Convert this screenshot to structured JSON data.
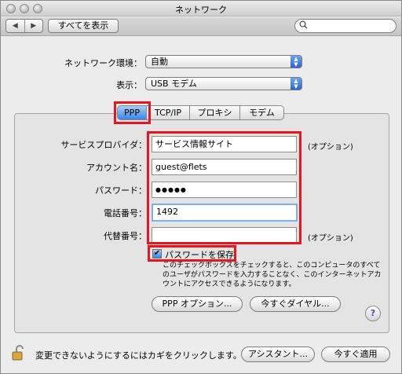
{
  "window": {
    "title": "ネットワーク"
  },
  "toolbar": {
    "back": "◀",
    "forward": "▶",
    "show_all": "すべてを表示",
    "search_placeholder": ""
  },
  "top": {
    "location_label": "ネットワーク環境：",
    "location_value": "自動",
    "show_label": "表示：",
    "show_value": "USB モデム"
  },
  "tabs": [
    "PPP",
    "TCP/IP",
    "プロキシ",
    "モデム"
  ],
  "form": {
    "service_provider_label": "サービスプロバイダ：",
    "service_provider_value": "サービス情報サイト",
    "service_provider_optional": "(オプション)",
    "account_label": "アカウント名：",
    "account_value": "guest@flets",
    "password_label": "パスワード：",
    "password_value": "●●●●●",
    "phone_label": "電話番号：",
    "phone_value": "1492",
    "alt_label": "代替番号：",
    "alt_value": "",
    "alt_optional": "(オプション)"
  },
  "save_password": {
    "label": "パスワードを保存",
    "checked": true,
    "help": "このチェックボックスをチェックすると、このコンピュータのすべてのユーザがパスワードを入力することなく、このインターネットアカウントにアクセスできるようになります。"
  },
  "buttons": {
    "ppp_options": "PPP オプション...",
    "dial_now": "今すぐダイヤル...",
    "help": "?",
    "assistant": "アシスタント...",
    "apply_now": "今すぐ適用"
  },
  "footer": {
    "lock_message": "変更できないようにするにはカギをクリックします。"
  },
  "colors": {
    "highlight_red": "#e8141e",
    "aqua_blue": "#3d84e6"
  }
}
